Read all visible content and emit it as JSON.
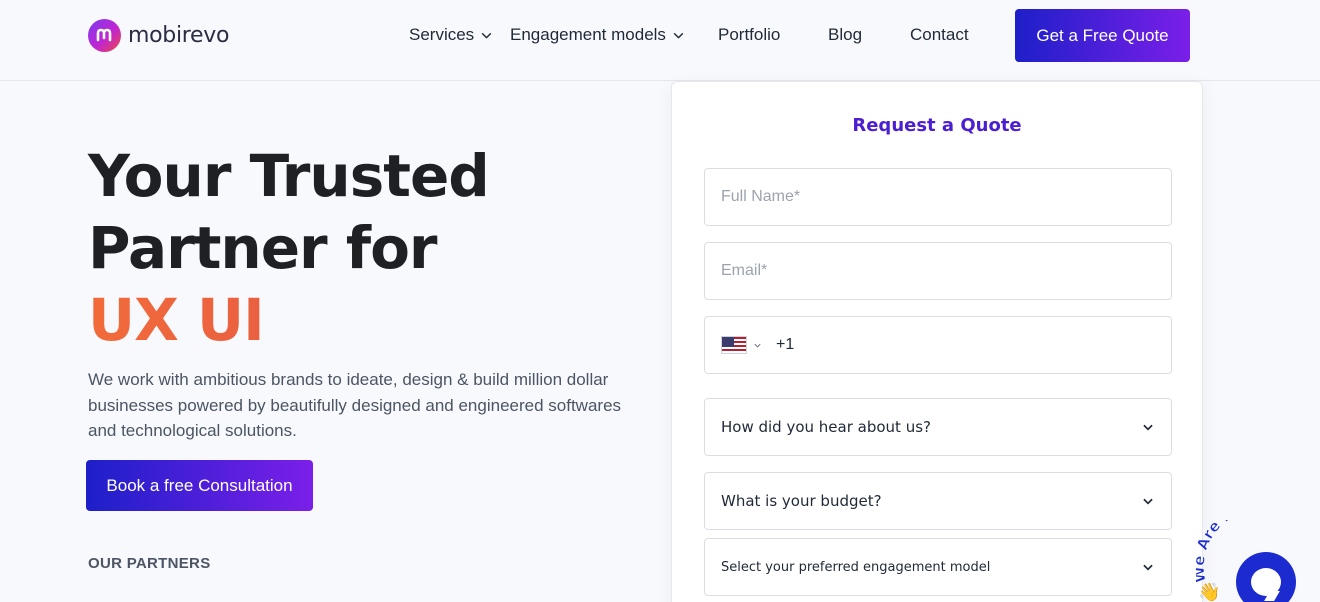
{
  "brand": {
    "name": "mobirevo",
    "accent": "#7b1fe8",
    "primary": "#1d1fc9",
    "orange": "#f26b3a"
  },
  "nav": {
    "items": [
      {
        "label": "Services",
        "dropdown": true
      },
      {
        "label": "Engagement models",
        "dropdown": true
      },
      {
        "label": "Portfolio",
        "dropdown": false
      },
      {
        "label": "Blog",
        "dropdown": false
      },
      {
        "label": "Contact",
        "dropdown": false
      }
    ],
    "cta_label": "Get a Free Quote"
  },
  "hero": {
    "title_line1": "Your Trusted",
    "title_line2": "Partner for",
    "title_accent": "UX UI",
    "description": "We work with ambitious brands to ideate, design & build million dollar businesses powered by beautifully designed and engineered softwares and technological solutions.",
    "cta_label": "Book a free Consultation",
    "partners_label": "OUR PARTNERS"
  },
  "form": {
    "title": "Request a Quote",
    "full_name_placeholder": "Full Name*",
    "email_placeholder": "Email*",
    "phone_code": "+1",
    "phone_country_icon": "us-flag-icon",
    "hear_about_label": "How did you hear about us?",
    "budget_label": "What is your budget?",
    "engagement_label": "Select your preferred engagement model"
  },
  "chat": {
    "badge_text": "We Are Here!",
    "icon": "chat-bubble-icon"
  }
}
